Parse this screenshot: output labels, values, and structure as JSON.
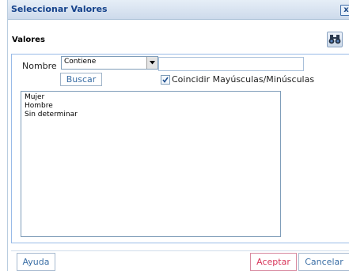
{
  "window": {
    "title": "Seleccionar Valores",
    "close_glyph": "x"
  },
  "section": {
    "label": "Valores",
    "find_icon": "binoculars-icon"
  },
  "filter": {
    "field_label": "Nombre",
    "operator_selected": "Contiene",
    "search_value": "",
    "search_button": "Buscar",
    "match_case_label": "Coincidir Mayúsculas/Minúsculas",
    "match_case_checked": true
  },
  "values_list": {
    "items": [
      "Mujer",
      "Hombre",
      "Sin determinar"
    ]
  },
  "footer": {
    "help_button": "Ayuda",
    "accept_button": "Aceptar",
    "cancel_button": "Cancelar"
  },
  "colors": {
    "title_text": "#15428b",
    "accept_accent": "#d8365a",
    "link_blue": "#3a6ea5"
  }
}
